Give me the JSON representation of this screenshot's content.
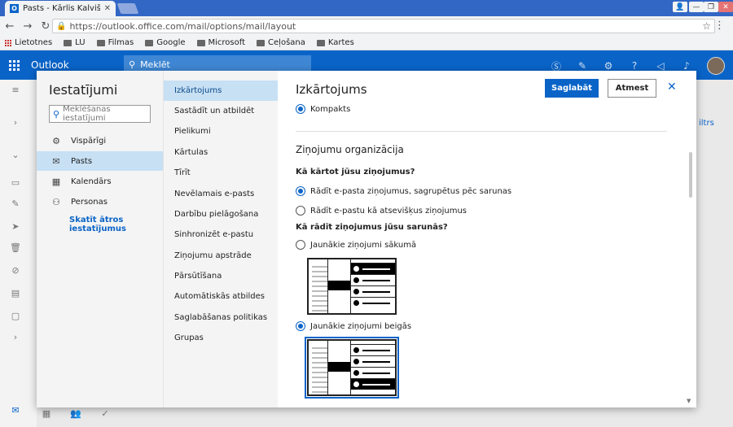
{
  "browser": {
    "tab_title": "Pasts - Kārlis Kalviški",
    "tab_icon_letter": "O",
    "url": "https://outlook.office.com/mail/options/mail/layout",
    "bookmarks": [
      "Lietotnes",
      "LU",
      "Filmas",
      "Google",
      "Microsoft",
      "Ceļošana",
      "Kartes"
    ]
  },
  "outlook": {
    "brand": "Outlook",
    "search_placeholder": "Meklēt"
  },
  "settings": {
    "title": "Iestatījumi",
    "search_placeholder": "Meklēšanas iestatījumi",
    "categories": [
      "Vispārīgi",
      "Pasts",
      "Kalendārs",
      "Personas"
    ],
    "selected_category": "Pasts",
    "quick_settings": "Skatīt ātros iestatījumus",
    "subcategories": [
      "Izkārtojums",
      "Sastādīt un atbildēt",
      "Pielikumi",
      "Kārtulas",
      "Tīrīt",
      "Nevēlamais e-pasts",
      "Darbību pielāgošana",
      "Sinhronizēt e-pastu",
      "Ziņojumu apstrāde",
      "Pārsūtīšana",
      "Automātiskās atbildes",
      "Saglabāšanas politikas",
      "Grupas"
    ],
    "selected_subcategory": "Izkārtojums"
  },
  "panel": {
    "title": "Izkārtojums",
    "save": "Saglabāt",
    "cancel": "Atmest",
    "density_option": "Kompakts",
    "section_title": "Ziņojumu organizācija",
    "q1": "Kā kārtot jūsu ziņojumus?",
    "q1_opt1": "Rādīt e-pasta ziņojumus, sagrupētus pēc sarunas",
    "q1_opt2": "Rādīt e-pastu kā atsevišķus ziņojumus",
    "q2": "Kā rādīt ziņojumus jūsu sarunās?",
    "q2_opt1": "Jaunākie ziņojumi sākumā",
    "q2_opt2": "Jaunākie ziņojumi beigās"
  },
  "background": {
    "filter_label": "iltrs"
  }
}
